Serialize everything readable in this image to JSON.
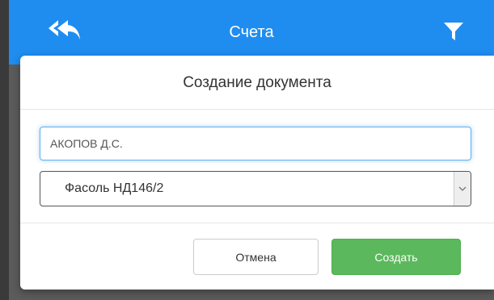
{
  "header": {
    "title": "Счета",
    "back_icon": "reply-all-icon",
    "filter_icon": "filter-icon",
    "color": "#1f8df0"
  },
  "dialog": {
    "title": "Создание документа",
    "customer_value": "АКОПОВ Д.С.",
    "product_selected": "Фасоль НД146/2",
    "cancel_label": "Отмена",
    "create_label": "Создать",
    "create_color": "#5cb85c"
  }
}
